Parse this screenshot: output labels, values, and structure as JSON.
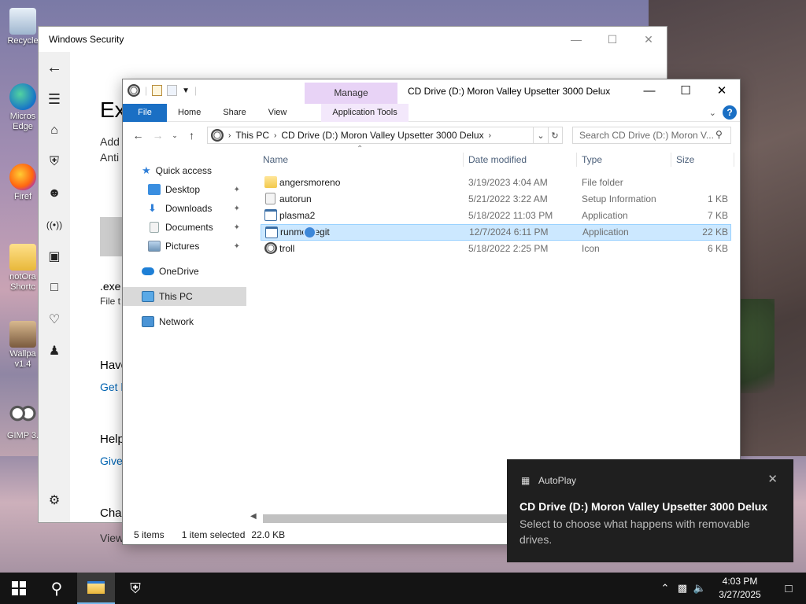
{
  "desktop": {
    "icons": [
      {
        "label": "Recycle"
      },
      {
        "label": "Micros Edge"
      },
      {
        "label": "Firef"
      },
      {
        "label": "notOra Shortc"
      },
      {
        "label": "Wallpa v1.4"
      },
      {
        "label": "GIMP 3."
      }
    ]
  },
  "security_window": {
    "title": "Windows Security",
    "heading": "Exclusi",
    "line1": "Add",
    "line2": "Anti",
    "ext_label": ".exe",
    "ext_sub": "File t",
    "have_head": "Have",
    "have_link": "Get h",
    "help_head": "Help",
    "help_link": "Give",
    "change_head": "Chan",
    "change_link": "View"
  },
  "explorer": {
    "title": "CD Drive (D:) Moron Valley Upsetter 3000 Delux",
    "manage_tab": "Manage",
    "ribbon_tabs": [
      "File",
      "Home",
      "Share",
      "View",
      "Application Tools"
    ],
    "breadcrumb": [
      "This PC",
      "CD Drive (D:) Moron Valley Upsetter 3000 Delux"
    ],
    "search_placeholder": "Search CD Drive (D:) Moron V...",
    "nav": {
      "quick_access": "Quick access",
      "desktop": "Desktop",
      "downloads": "Downloads",
      "documents": "Documents",
      "pictures": "Pictures",
      "onedrive": "OneDrive",
      "this_pc": "This PC",
      "network": "Network"
    },
    "columns": {
      "name": "Name",
      "date": "Date modified",
      "type": "Type",
      "size": "Size"
    },
    "files": [
      {
        "name": "angersmoreno",
        "date": "3/19/2023 4:04 AM",
        "type": "File folder",
        "size": ""
      },
      {
        "name": "autorun",
        "date": "5/21/2022 3:22 AM",
        "type": "Setup Information",
        "size": "1 KB"
      },
      {
        "name": "plasma2",
        "date": "5/18/2022 11:03 PM",
        "type": "Application",
        "size": "7 KB"
      },
      {
        "name": "runme_legit",
        "date": "12/7/2024 6:11 PM",
        "type": "Application",
        "size": "22 KB"
      },
      {
        "name": "troll",
        "date": "5/18/2022 2:25 PM",
        "type": "Icon",
        "size": "6 KB"
      }
    ],
    "status": {
      "count": "5 items",
      "selected": "1 item selected",
      "size": "22.0 KB"
    }
  },
  "toast": {
    "app": "AutoPlay",
    "title": "CD Drive (D:) Moron Valley Upsetter 3000 Delux",
    "body": "Select to choose what happens with removable drives."
  },
  "taskbar": {
    "time": "4:03 PM",
    "date": "3/27/2025"
  },
  "colors": {
    "accent": "#1a6fc4",
    "selection": "#cce8ff",
    "manage": "#e8d3f6"
  }
}
